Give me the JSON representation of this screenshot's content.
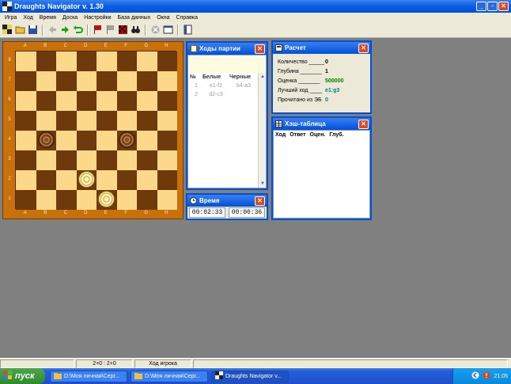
{
  "window": {
    "title": "Draughts Navigator v. 1.30"
  },
  "menu": [
    "Игра",
    "Ход",
    "Время",
    "Доска",
    "Настройки",
    "База данных",
    "Окна",
    "Справка"
  ],
  "board": {
    "files": [
      "A",
      "B",
      "C",
      "D",
      "E",
      "F",
      "G",
      "H"
    ],
    "ranks": [
      "8",
      "7",
      "6",
      "5",
      "4",
      "3",
      "2",
      "1"
    ],
    "colors": {
      "light": "#fcd88a",
      "dark": "#6e3a0c",
      "frame": "#c8700a"
    },
    "pieces": [
      {
        "square": "b4",
        "color": "black"
      },
      {
        "square": "f4",
        "color": "black"
      },
      {
        "square": "d2",
        "color": "white"
      },
      {
        "square": "e1",
        "color": "white"
      }
    ]
  },
  "moves_panel": {
    "title": "Ходы партии",
    "headers": [
      "№",
      "Белые",
      "Черные"
    ],
    "rows": [
      {
        "n": "1",
        "white": "e1-f2",
        "black": "b4-a3"
      },
      {
        "n": "2",
        "white": "d2-c3",
        "black": ""
      }
    ]
  },
  "time_panel": {
    "title": "Время",
    "white_time": "00:02:33",
    "black_time": "00:00:36"
  },
  "calc_panel": {
    "title": "Расчет",
    "rows": [
      {
        "label": "Количество _____",
        "value": "0",
        "color": "#000000"
      },
      {
        "label": "Глубина _______",
        "value": "1",
        "color": "#000000"
      },
      {
        "label": "Оценка _______",
        "value": "500000",
        "color": "#008000"
      },
      {
        "label": "Лучший ход ____",
        "value": "e1:g3",
        "color": "#008080"
      },
      {
        "label": "Прочитано из ЭБ",
        "value": "0",
        "color": "#008080"
      }
    ]
  },
  "hash_panel": {
    "title": "Хэш-таблица",
    "headers": [
      "Ход",
      "Ответ",
      "Оцен.",
      "Глуб."
    ]
  },
  "statusbar": {
    "clock": "2+0 : 2+0",
    "status": "Ход игрока"
  },
  "taskbar": {
    "start": "пуск",
    "tasks": [
      {
        "label": "D:\\Моя личная\\Серг...",
        "active": false
      },
      {
        "label": "D:\\Моя личная\\Серг...",
        "active": false
      },
      {
        "label": "Draughts Navigator v...",
        "active": true
      }
    ],
    "lang": "RU",
    "time": "21:05"
  }
}
